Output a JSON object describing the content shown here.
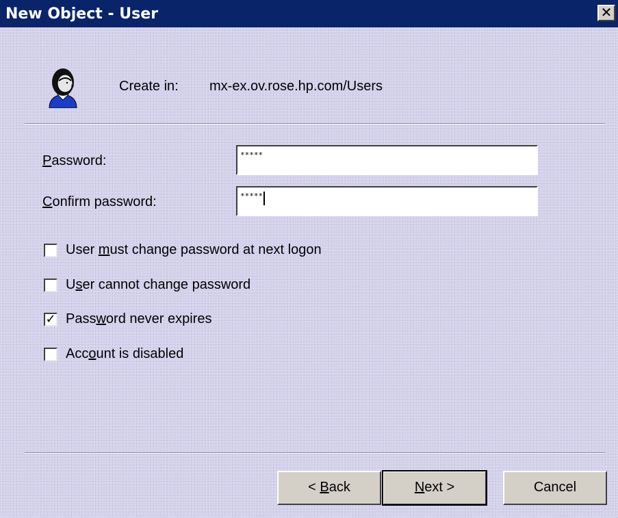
{
  "window": {
    "title": "New Object - User",
    "close_glyph": "✕"
  },
  "header": {
    "icon": "user-avatar-icon",
    "create_in_label": "Create in:",
    "create_in_path": "mx-ex.ov.rose.hp.com/Users"
  },
  "fields": {
    "password": {
      "label_accel": "P",
      "label_rest": "assword:",
      "value": "*****"
    },
    "confirm_password": {
      "label_accel": "C",
      "label_rest": "onfirm password:",
      "value": "*****"
    }
  },
  "options": {
    "must_change": {
      "pre": "User ",
      "accel": "m",
      "post": "ust change password at next logon",
      "checked": false
    },
    "cannot_change": {
      "pre": "U",
      "accel": "s",
      "post": "er cannot change password",
      "checked": false
    },
    "never_expires": {
      "pre": "Pass",
      "accel": "w",
      "post": "ord never expires",
      "checked": true,
      "check_glyph": "✓"
    },
    "disabled": {
      "pre": "Acc",
      "accel": "o",
      "post": "unt is disabled",
      "checked": false
    }
  },
  "buttons": {
    "back": {
      "prefix": "< ",
      "accel": "B",
      "rest": "ack"
    },
    "next": {
      "accel": "N",
      "rest": "ext >"
    },
    "cancel": {
      "label": "Cancel"
    }
  },
  "colors": {
    "titlebar": "#0a246a",
    "dialog_bg": "#d3d0ea"
  }
}
